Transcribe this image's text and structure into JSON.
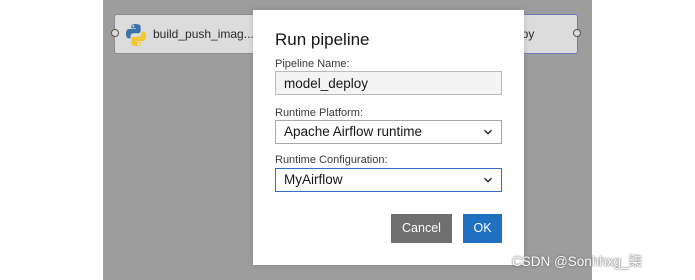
{
  "canvas": {
    "nodes": [
      {
        "label": "build_push_imag...",
        "icon": "python-icon"
      },
      {
        "label": "el.py",
        "icon": ""
      }
    ]
  },
  "dialog": {
    "title": "Run pipeline",
    "pipeline_name": {
      "label": "Pipeline Name:",
      "value": "model_deploy"
    },
    "runtime_platform": {
      "label": "Runtime Platform:",
      "value": "Apache Airflow runtime"
    },
    "runtime_configuration": {
      "label": "Runtime Configuration:",
      "value": "MyAirflow"
    },
    "buttons": {
      "cancel": "Cancel",
      "ok": "OK"
    }
  },
  "watermark": "CSDN @Sonhhxg_柒",
  "colors": {
    "primary": "#1f70c1",
    "secondary": "#6f6f6f",
    "overlay": "#9d9d9d"
  }
}
